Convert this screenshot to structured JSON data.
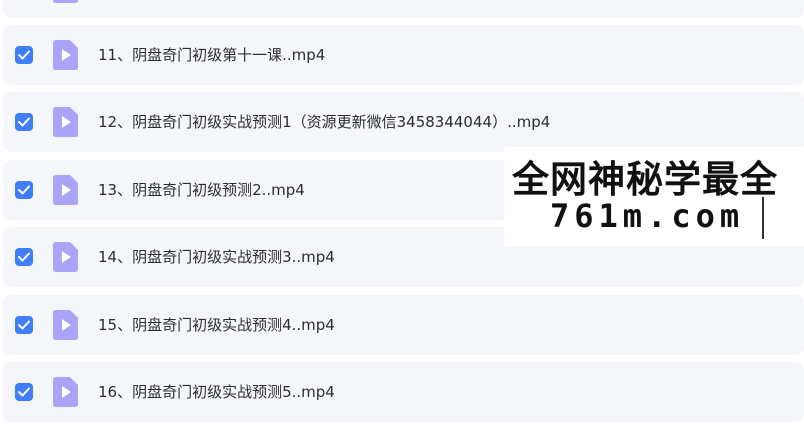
{
  "colors": {
    "row_background": "#f5f6fa",
    "checkbox": "#3f7ef6",
    "file_icon": "#a9a4f7",
    "text": "#2b2d33"
  },
  "files": [
    {
      "name": "",
      "checked": true,
      "icon": "video-file-icon"
    },
    {
      "name": "11、阴盘奇门初级第十一课..mp4",
      "checked": true,
      "icon": "video-file-icon"
    },
    {
      "name": "12、阴盘奇门初级实战预测1（资源更新微信3458344044）..mp4",
      "checked": true,
      "icon": "video-file-icon"
    },
    {
      "name": "13、阴盘奇门初级预测2..mp4",
      "checked": true,
      "icon": "video-file-icon"
    },
    {
      "name": "14、阴盘奇门初级实战预测3..mp4",
      "checked": true,
      "icon": "video-file-icon"
    },
    {
      "name": "15、阴盘奇门初级实战预测4..mp4",
      "checked": true,
      "icon": "video-file-icon"
    },
    {
      "name": "16、阴盘奇门初级实战预测5..mp4",
      "checked": true,
      "icon": "video-file-icon"
    }
  ],
  "watermark": {
    "line1": "全网神秘学最全",
    "line2": "761m.com"
  }
}
